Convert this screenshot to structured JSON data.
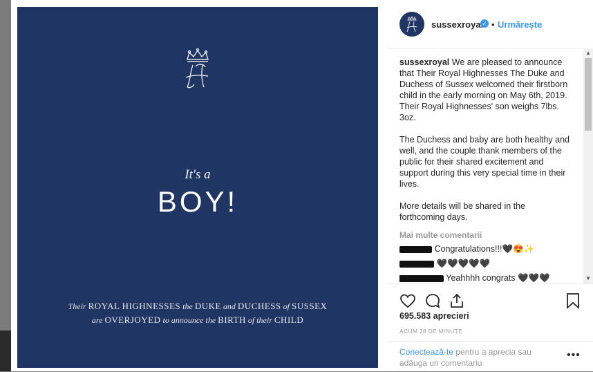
{
  "image": {
    "its_a": "It's a",
    "boy": "BOY!",
    "line1": [
      {
        "t": "Their ",
        "s": "it"
      },
      {
        "t": "ROYAL HIGHNESSES",
        "s": "sc"
      },
      {
        "t": " the ",
        "s": "it"
      },
      {
        "t": "DUKE",
        "s": "sc"
      },
      {
        "t": " and ",
        "s": "it"
      },
      {
        "t": "DUCHESS",
        "s": "sc"
      },
      {
        "t": " of ",
        "s": "it"
      },
      {
        "t": "SUSSEX",
        "s": "sc"
      }
    ],
    "line2": [
      {
        "t": "are ",
        "s": "it"
      },
      {
        "t": "OVERJOYED",
        "s": "sc"
      },
      {
        "t": " to announce the ",
        "s": "it"
      },
      {
        "t": "BIRTH",
        "s": "sc"
      },
      {
        "t": " of their ",
        "s": "it"
      },
      {
        "t": "CHILD",
        "s": "sc"
      }
    ]
  },
  "header": {
    "username": "sussexroyal",
    "dot": "•",
    "follow_label": "Urmărește"
  },
  "caption": {
    "author": "sussexroyal",
    "p1": " We are pleased to announce that Their Royal Highnesses The Duke and Duchess of Sussex welcomed their firstborn child in the early morning on May 6th, 2019. Their Royal Highnesses' son weighs 7lbs. 3oz.",
    "p2": "The Duchess and baby are both healthy and well, and the couple thank members of the public for their shared excitement and support during this very special time in their lives.",
    "p3": "More details will be shared in the forthcoming days."
  },
  "more_comments_label": "Mai multe comentarii",
  "comments": [
    {
      "text": "Congratulations!!!🖤😍✨"
    },
    {
      "text": "🖤🖤🖤🖤🖤"
    },
    {
      "text": "Yeahhhh congrats 🖤🖤🖤"
    }
  ],
  "likes": "695.583 aprecieri",
  "time": "ACUM 28 DE MINUTE",
  "login": {
    "link": "Conectează-te",
    "text": " pentru a aprecia sau adăuga un comentariu",
    "options": "•••"
  },
  "colors": {
    "navy": "#1f3563",
    "link_blue": "#3897f0"
  },
  "icons": [
    "heart-icon",
    "comment-icon",
    "share-icon",
    "bookmark-icon",
    "verified-badge-icon",
    "more-options-icon"
  ]
}
